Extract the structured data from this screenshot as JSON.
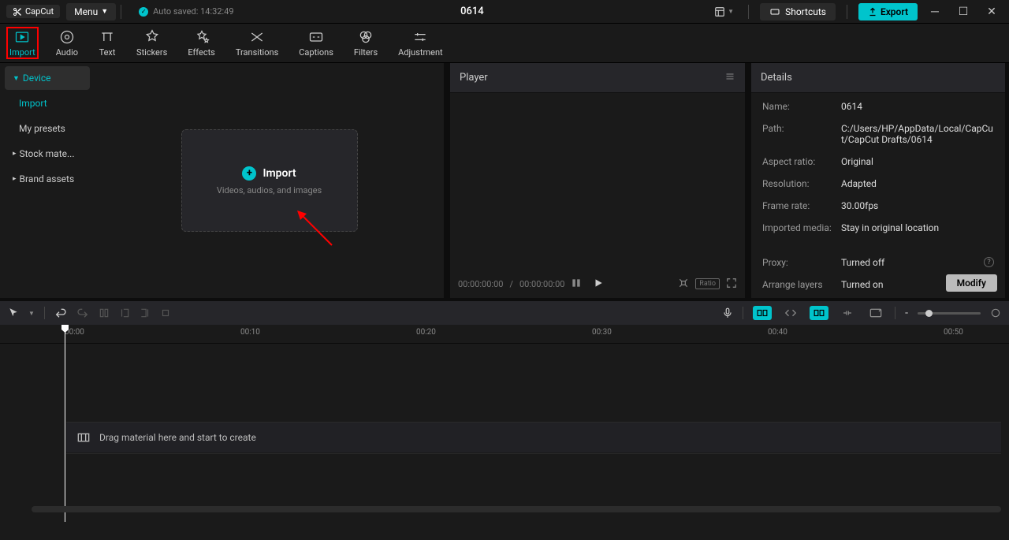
{
  "titlebar": {
    "app_name": "CapCut",
    "menu_label": "Menu",
    "autosave_label": "Auto saved: 14:32:49",
    "project_title": "0614",
    "shortcuts_label": "Shortcuts",
    "export_label": "Export"
  },
  "top_tabs": [
    {
      "label": "Import",
      "icon": "import"
    },
    {
      "label": "Audio",
      "icon": "audio"
    },
    {
      "label": "Text",
      "icon": "text"
    },
    {
      "label": "Stickers",
      "icon": "stickers"
    },
    {
      "label": "Effects",
      "icon": "effects"
    },
    {
      "label": "Transitions",
      "icon": "transitions"
    },
    {
      "label": "Captions",
      "icon": "captions"
    },
    {
      "label": "Filters",
      "icon": "filters"
    },
    {
      "label": "Adjustment",
      "icon": "adjustment"
    }
  ],
  "sidebar": {
    "items": [
      {
        "label": "Device",
        "expanded": true,
        "active": true
      },
      {
        "label": "Import",
        "sub": true
      },
      {
        "label": "My presets",
        "sub2": true
      },
      {
        "label": "Stock mate...",
        "expanded": false
      },
      {
        "label": "Brand assets",
        "expanded": false
      }
    ]
  },
  "import_drop": {
    "title": "Import",
    "subtitle": "Videos, audios, and images"
  },
  "player": {
    "title": "Player",
    "time_current": "00:00:00:00",
    "time_total": "00:00:00:00",
    "ratio_label": "Ratio"
  },
  "details": {
    "title": "Details",
    "rows": [
      {
        "label": "Name:",
        "value": "0614"
      },
      {
        "label": "Path:",
        "value": "C:/Users/HP/AppData/Local/CapCut/CapCut Drafts/0614"
      },
      {
        "label": "Aspect ratio:",
        "value": "Original"
      },
      {
        "label": "Resolution:",
        "value": "Adapted"
      },
      {
        "label": "Frame rate:",
        "value": "30.00fps"
      },
      {
        "label": "Imported media:",
        "value": "Stay in original location"
      },
      {
        "label": "Proxy:",
        "value": "Turned off",
        "info": true
      },
      {
        "label": "Arrange layers",
        "value": "Turned on",
        "info": true
      }
    ],
    "modify_label": "Modify"
  },
  "timeline": {
    "ruler_marks": [
      "00:00",
      "00:10",
      "00:20",
      "00:30",
      "00:40",
      "00:50"
    ],
    "hint": "Drag material here and start to create",
    "zoom_minus": "-"
  }
}
